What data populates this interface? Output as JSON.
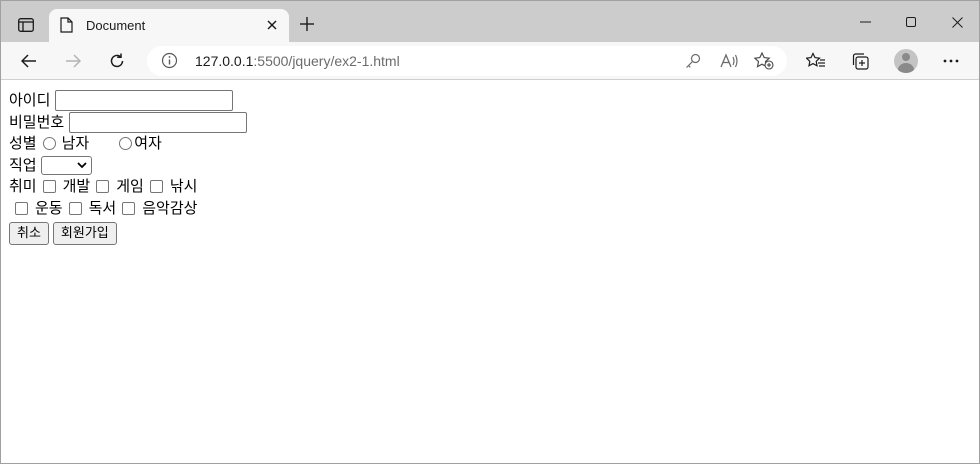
{
  "browser": {
    "tab": {
      "title": "Document"
    },
    "address": {
      "host": "127.0.0.1",
      "rest": ":5500/jquery/ex2-1.html"
    },
    "icons": {
      "tab_actions": "tab-actions-icon",
      "favicon": "document-icon",
      "tab_close": "close-icon",
      "new_tab": "plus-icon",
      "minimize": "minimize-icon",
      "maximize": "maximize-icon",
      "close_window": "close-icon",
      "back": "back-arrow-icon",
      "forward": "forward-arrow-icon",
      "refresh": "refresh-icon",
      "site_info": "info-icon",
      "password": "key-icon",
      "read_aloud": "read-aloud-icon",
      "add_favorite": "star-add-icon",
      "favorites": "favorites-icon",
      "collections": "collections-icon",
      "profile": "profile-avatar",
      "more": "more-icon"
    }
  },
  "form": {
    "id_label": "아이디",
    "id_value": "",
    "password_label": "비밀번호",
    "password_value": "",
    "gender_label": "성별",
    "gender_options": [
      "남자",
      "여자"
    ],
    "job_label": "직업",
    "job_selected": "",
    "hobby_label": "취미",
    "hobbies_row1": [
      "개발",
      "게임",
      "낚시"
    ],
    "hobbies_row2": [
      "운동",
      "독서",
      "음악감상"
    ],
    "cancel_button": "취소",
    "signup_button": "회원가입"
  }
}
